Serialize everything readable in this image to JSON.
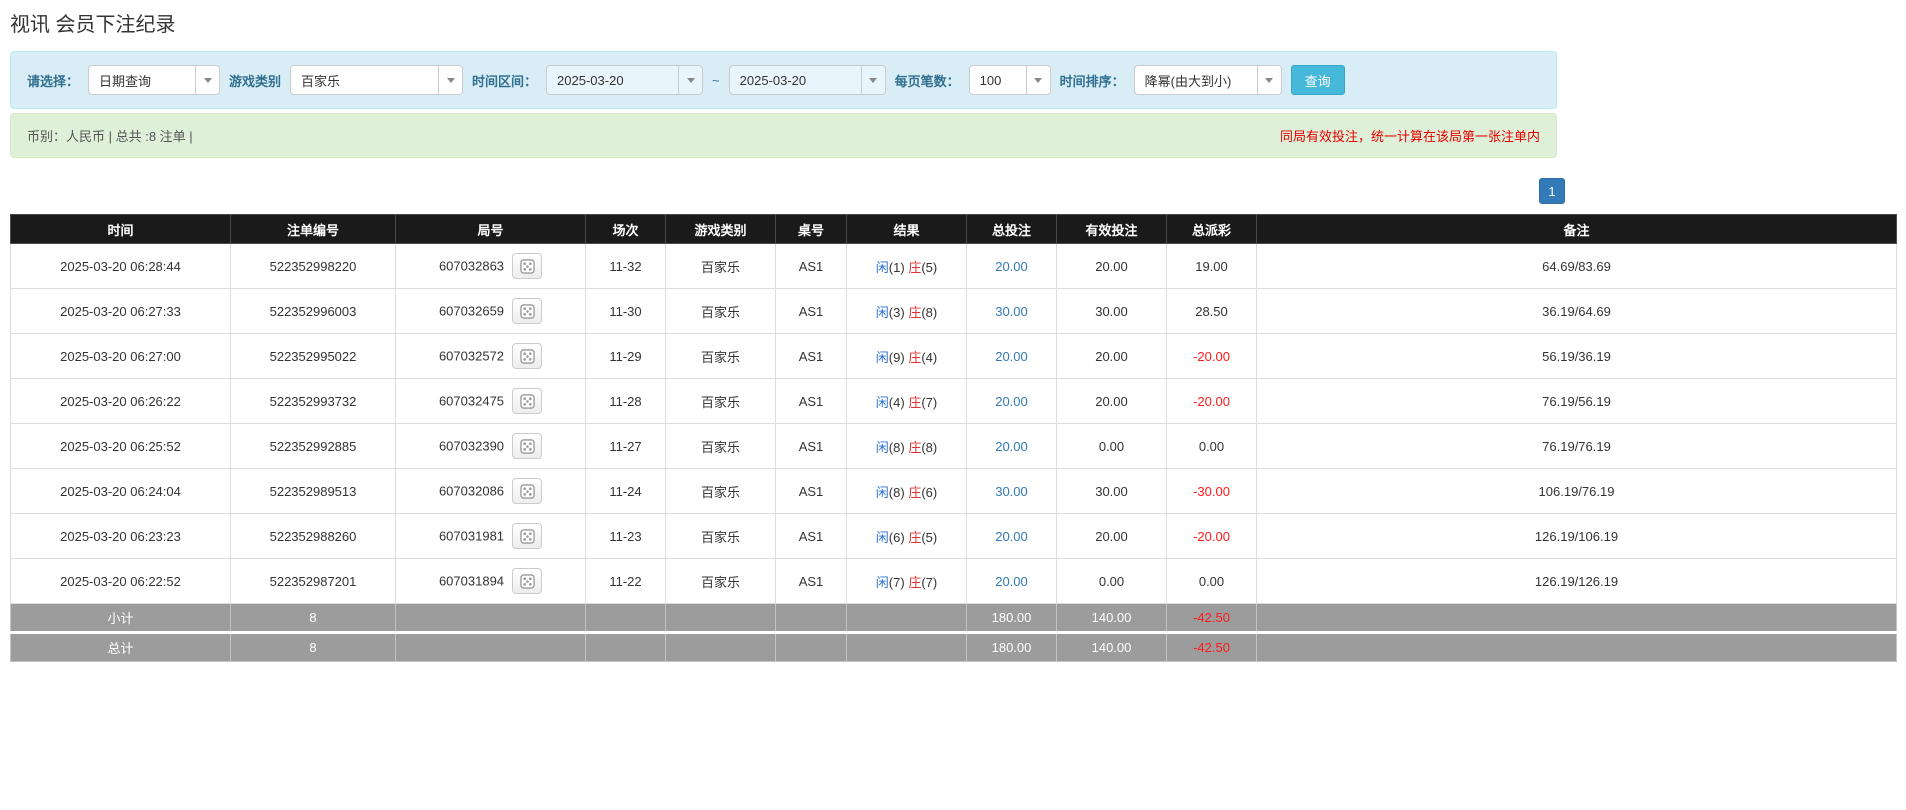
{
  "page": {
    "title": "视讯 会员下注纪录"
  },
  "filters": {
    "select_label": "请选择：",
    "select_value": "日期查询",
    "game_type_label": "游戏类别",
    "game_type_value": "百家乐",
    "date_range_label": "时间区间：",
    "date_from": "2025-03-20",
    "date_separator": "~",
    "date_to": "2025-03-20",
    "page_size_label": "每页笔数：",
    "page_size_value": "100",
    "sort_label": "时间排序：",
    "sort_value": "降幂(由大到小)",
    "search_button": "查询"
  },
  "summary": {
    "left": "币别：人民币 | 总共 :8 注单 |",
    "right": "同局有效投注，统一计算在该局第一张注单内"
  },
  "pagination": {
    "current": "1"
  },
  "table": {
    "headers": [
      "时间",
      "注单编号",
      "局号",
      "场次",
      "游戏类别",
      "桌号",
      "结果",
      "总投注",
      "有效投注",
      "总派彩",
      "备注"
    ],
    "rows": [
      {
        "time": "2025-03-20 06:28:44",
        "bet_id": "522352998220",
        "round_id": "607032863",
        "session": "11-32",
        "game": "百家乐",
        "table_no": "AS1",
        "player": "闲",
        "player_score": "(1)",
        "banker": "庄",
        "banker_score": "(5)",
        "total_bet": "20.00",
        "valid_bet": "20.00",
        "payout": "19.00",
        "remark": "64.69/83.69"
      },
      {
        "time": "2025-03-20 06:27:33",
        "bet_id": "522352996003",
        "round_id": "607032659",
        "session": "11-30",
        "game": "百家乐",
        "table_no": "AS1",
        "player": "闲",
        "player_score": "(3)",
        "banker": "庄",
        "banker_score": "(8)",
        "total_bet": "30.00",
        "valid_bet": "30.00",
        "payout": "28.50",
        "remark": "36.19/64.69"
      },
      {
        "time": "2025-03-20 06:27:00",
        "bet_id": "522352995022",
        "round_id": "607032572",
        "session": "11-29",
        "game": "百家乐",
        "table_no": "AS1",
        "player": "闲",
        "player_score": "(9)",
        "banker": "庄",
        "banker_score": "(4)",
        "total_bet": "20.00",
        "valid_bet": "20.00",
        "payout": "-20.00",
        "remark": "56.19/36.19"
      },
      {
        "time": "2025-03-20 06:26:22",
        "bet_id": "522352993732",
        "round_id": "607032475",
        "session": "11-28",
        "game": "百家乐",
        "table_no": "AS1",
        "player": "闲",
        "player_score": "(4)",
        "banker": "庄",
        "banker_score": "(7)",
        "total_bet": "20.00",
        "valid_bet": "20.00",
        "payout": "-20.00",
        "remark": "76.19/56.19"
      },
      {
        "time": "2025-03-20 06:25:52",
        "bet_id": "522352992885",
        "round_id": "607032390",
        "session": "11-27",
        "game": "百家乐",
        "table_no": "AS1",
        "player": "闲",
        "player_score": "(8)",
        "banker": "庄",
        "banker_score": "(8)",
        "total_bet": "20.00",
        "valid_bet": "0.00",
        "payout": "0.00",
        "remark": "76.19/76.19"
      },
      {
        "time": "2025-03-20 06:24:04",
        "bet_id": "522352989513",
        "round_id": "607032086",
        "session": "11-24",
        "game": "百家乐",
        "table_no": "AS1",
        "player": "闲",
        "player_score": "(8)",
        "banker": "庄",
        "banker_score": "(6)",
        "total_bet": "30.00",
        "valid_bet": "30.00",
        "payout": "-30.00",
        "remark": "106.19/76.19"
      },
      {
        "time": "2025-03-20 06:23:23",
        "bet_id": "522352988260",
        "round_id": "607031981",
        "session": "11-23",
        "game": "百家乐",
        "table_no": "AS1",
        "player": "闲",
        "player_score": "(6)",
        "banker": "庄",
        "banker_score": "(5)",
        "total_bet": "20.00",
        "valid_bet": "20.00",
        "payout": "-20.00",
        "remark": "126.19/106.19"
      },
      {
        "time": "2025-03-20 06:22:52",
        "bet_id": "522352987201",
        "round_id": "607031894",
        "session": "11-22",
        "game": "百家乐",
        "table_no": "AS1",
        "player": "闲",
        "player_score": "(7)",
        "banker": "庄",
        "banker_score": "(7)",
        "total_bet": "20.00",
        "valid_bet": "0.00",
        "payout": "0.00",
        "remark": "126.19/126.19"
      }
    ],
    "subtotal": {
      "label": "小计",
      "count": "8",
      "total_bet": "180.00",
      "valid_bet": "140.00",
      "payout": "-42.50"
    },
    "total": {
      "label": "总计",
      "count": "8",
      "total_bet": "180.00",
      "valid_bet": "140.00",
      "payout": "-42.50"
    }
  },
  "colors": {
    "accent_blue": "#337ab7",
    "player_blue": "#2a6fd2",
    "banker_red": "#e03232",
    "negative_red": "#ff1a1a",
    "filter_bg": "#d9edf7",
    "summary_bg": "#dff0d8",
    "header_bg": "#1a1a1a",
    "footer_bg": "#9c9c9c",
    "search_btn": "#46b8da"
  }
}
